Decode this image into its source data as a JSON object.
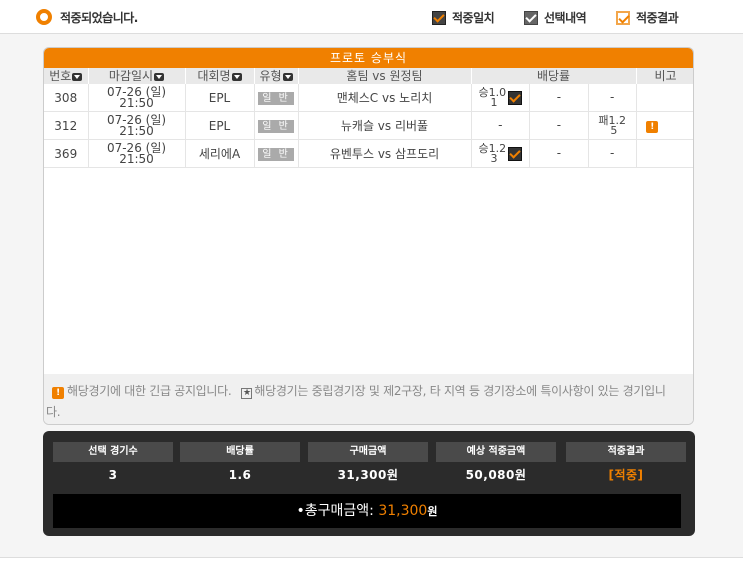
{
  "top": {
    "status_text": "적중되었습니다.",
    "legend": [
      {
        "label": "적중일치",
        "icon": "checked-box-dark-icon"
      },
      {
        "label": "선택내역",
        "icon": "checked-box-gray-icon"
      },
      {
        "label": "적중결과",
        "icon": "checked-box-orange-icon"
      }
    ]
  },
  "panel": {
    "title": "프로토 승부식",
    "columns": [
      "번호",
      "마감일시",
      "대회명",
      "유형",
      "홈팀 vs 원정팀",
      "배당률",
      "비고"
    ],
    "rows": [
      {
        "no": "308",
        "date": "07-26 (일)",
        "time": "21:50",
        "league": "EPL",
        "type": "일 반",
        "match": "맨체스C vs 노리치",
        "odds_win_label": "승",
        "odds_win_a": "1.0",
        "odds_win_b": "1",
        "odds_draw": "-",
        "odds_lose": "-",
        "odds_lose_label": "",
        "odds_lose_a": "",
        "odds_lose_b": "",
        "note": ""
      },
      {
        "no": "312",
        "date": "07-26 (일)",
        "time": "21:50",
        "league": "EPL",
        "type": "일 반",
        "match": "뉴캐슬 vs 리버풀",
        "odds_win": "-",
        "odds_draw": "-",
        "odds_lose_label": "패",
        "odds_lose_a": "1.2",
        "odds_lose_b": "5",
        "note": "!"
      },
      {
        "no": "369",
        "date": "07-26 (일)",
        "time": "21:50",
        "league": "세리에A",
        "type": "일 반",
        "match": "유벤투스 vs 삼프도리",
        "odds_win_label": "승",
        "odds_win_a": "1.2",
        "odds_win_b": "3",
        "odds_draw": "-",
        "odds_lose": "-",
        "note": ""
      }
    ],
    "notice_line1": "해당경기에 대한 긴급 공지입니다.",
    "notice_line2": "해당경기는 중립경기장 및 제2구장, 타 지역 등 경기장소에 특이사항이 있는 경기입니",
    "notice_line3": "다."
  },
  "summary": {
    "labels": [
      "선택 경기수",
      "배당률",
      "구매금액",
      "예상 적중금액",
      "적중결과"
    ],
    "values": [
      "3",
      "1.6",
      "31,300원",
      "50,080원",
      "[적중]"
    ],
    "total_prefix": "•총구매금액: ",
    "total_amount": "31,300",
    "total_unit": "원"
  },
  "colors": {
    "accent": "#f08000",
    "dark": "#2b2b2b"
  }
}
